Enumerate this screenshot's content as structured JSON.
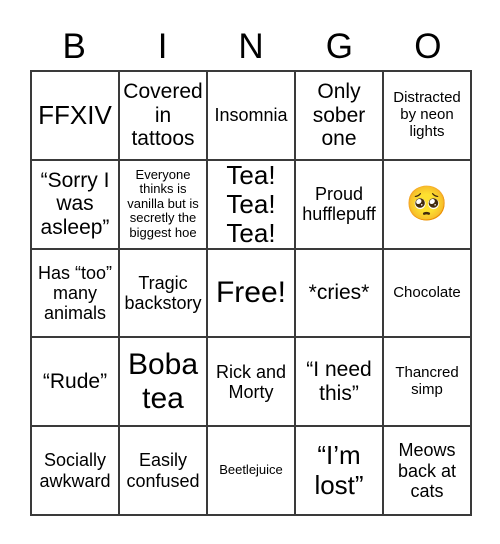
{
  "header": {
    "letters": [
      "B",
      "I",
      "N",
      "G",
      "O"
    ]
  },
  "grid": {
    "rows": [
      [
        {
          "text": "FFXIV",
          "size": "fs-xl"
        },
        {
          "text": "Covered in tattoos",
          "size": "fs-lg"
        },
        {
          "text": "Insomnia",
          "size": "fs-md"
        },
        {
          "text": "Only sober one",
          "size": "fs-lg"
        },
        {
          "text": "Distracted by neon lights",
          "size": "fs-sm"
        }
      ],
      [
        {
          "text": "“Sorry I was asleep”",
          "size": "fs-lg"
        },
        {
          "text": "Everyone thinks is vanilla but is secretly the biggest hoe",
          "size": "fs-xs"
        },
        {
          "text": "Tea! Tea! Tea!",
          "size": "fs-xl"
        },
        {
          "text": "Proud hufflepuff",
          "size": "fs-md"
        },
        {
          "text": "🥺",
          "size": "fs-emoji"
        }
      ],
      [
        {
          "text": "Has “too” many animals",
          "size": "fs-md"
        },
        {
          "text": "Tragic backstory",
          "size": "fs-md"
        },
        {
          "text": "Free!",
          "size": "fs-xxl"
        },
        {
          "text": "*cries*",
          "size": "fs-lg"
        },
        {
          "text": "Chocolate",
          "size": "fs-sm"
        }
      ],
      [
        {
          "text": "“Rude”",
          "size": "fs-lg"
        },
        {
          "text": "Boba tea",
          "size": "fs-xxl"
        },
        {
          "text": "Rick and Morty",
          "size": "fs-md"
        },
        {
          "text": "“I need this”",
          "size": "fs-lg"
        },
        {
          "text": "Thancred simp",
          "size": "fs-sm"
        }
      ],
      [
        {
          "text": "Socially awkward",
          "size": "fs-md"
        },
        {
          "text": "Easily confused",
          "size": "fs-md"
        },
        {
          "text": "Beetlejuice",
          "size": "fs-xs"
        },
        {
          "text": "“I’m lost”",
          "size": "fs-xl"
        },
        {
          "text": "Meows back at cats",
          "size": "fs-md"
        }
      ]
    ]
  },
  "colors": {
    "border": "#3a3a3a",
    "background": "#ffffff",
    "text": "#000000"
  }
}
